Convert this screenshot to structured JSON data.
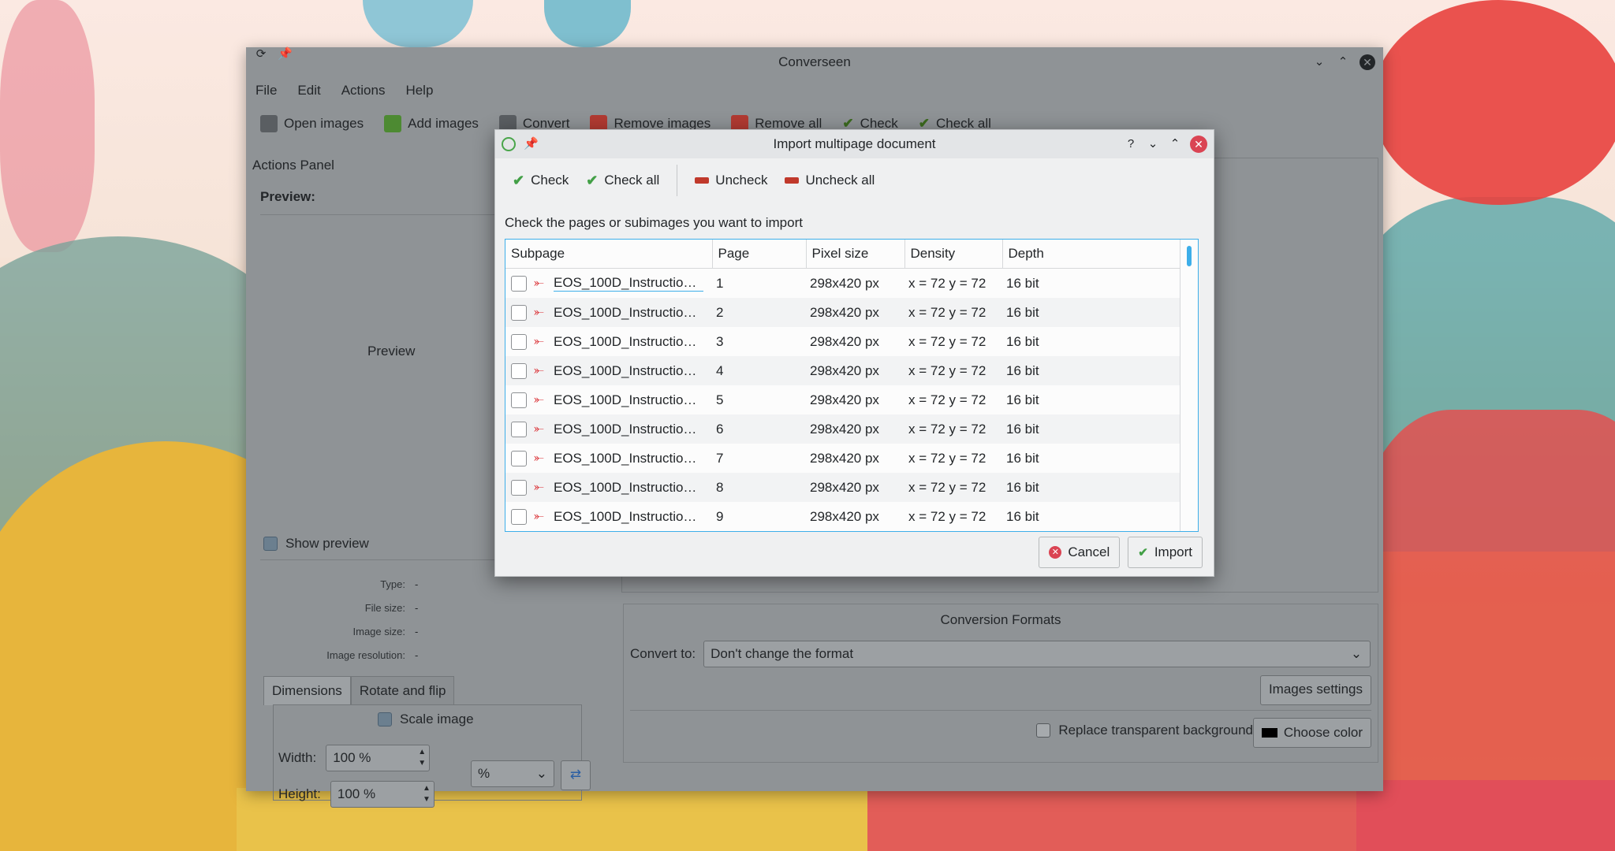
{
  "main_window": {
    "title": "Converseen",
    "menu": [
      "File",
      "Edit",
      "Actions",
      "Help"
    ],
    "toolbar": [
      {
        "label": "Open images",
        "icon": "open-images-icon"
      },
      {
        "label": "Add images",
        "icon": "add-images-icon"
      },
      {
        "label": "Convert",
        "icon": "convert-icon"
      },
      {
        "label": "Remove images",
        "icon": "remove-images-icon"
      },
      {
        "label": "Remove all",
        "icon": "remove-all-icon"
      },
      {
        "label": "Check",
        "icon": "check-icon"
      },
      {
        "label": "Check all",
        "icon": "check-all-icon"
      }
    ],
    "actions_panel": {
      "title": "Actions Panel",
      "preview_label": "Preview:",
      "preview_placeholder": "Preview",
      "show_preview_label": "Show preview",
      "info": [
        {
          "key": "Type:",
          "value": "-"
        },
        {
          "key": "File size:",
          "value": "-"
        },
        {
          "key": "Image size:",
          "value": "-"
        },
        {
          "key": "Image resolution:",
          "value": "-"
        }
      ],
      "tabs": [
        "Dimensions",
        "Rotate and flip"
      ],
      "scale_image_label": "Scale image",
      "width_label": "Width:",
      "width_value": "100 %",
      "height_label": "Height:",
      "height_value": "100 %",
      "unit_value": "%"
    },
    "conversion_formats": {
      "title": "Conversion Formats",
      "convert_to_label": "Convert to:",
      "convert_to_value": "Don't change the format",
      "images_settings_label": "Images settings",
      "replace_bg_label": "Replace transparent background",
      "choose_color_label": "Choose color"
    }
  },
  "dialog": {
    "title": "Import multipage document",
    "toolbar": {
      "check": "Check",
      "check_all": "Check all",
      "uncheck": "Uncheck",
      "uncheck_all": "Uncheck all"
    },
    "instruction": "Check the pages or subimages you want to import",
    "columns": [
      "Subpage",
      "Page",
      "Pixel size",
      "Density",
      "Depth"
    ],
    "rows": [
      {
        "subpage": "EOS_100D_Instruction_...",
        "page": "1",
        "pixel_size": "298x420 px",
        "density": "x = 72 y = 72",
        "depth": "16 bit"
      },
      {
        "subpage": "EOS_100D_Instruction_...",
        "page": "2",
        "pixel_size": "298x420 px",
        "density": "x = 72 y = 72",
        "depth": "16 bit"
      },
      {
        "subpage": "EOS_100D_Instruction_...",
        "page": "3",
        "pixel_size": "298x420 px",
        "density": "x = 72 y = 72",
        "depth": "16 bit"
      },
      {
        "subpage": "EOS_100D_Instruction_...",
        "page": "4",
        "pixel_size": "298x420 px",
        "density": "x = 72 y = 72",
        "depth": "16 bit"
      },
      {
        "subpage": "EOS_100D_Instruction_...",
        "page": "5",
        "pixel_size": "298x420 px",
        "density": "x = 72 y = 72",
        "depth": "16 bit"
      },
      {
        "subpage": "EOS_100D_Instruction_...",
        "page": "6",
        "pixel_size": "298x420 px",
        "density": "x = 72 y = 72",
        "depth": "16 bit"
      },
      {
        "subpage": "EOS_100D_Instruction_...",
        "page": "7",
        "pixel_size": "298x420 px",
        "density": "x = 72 y = 72",
        "depth": "16 bit"
      },
      {
        "subpage": "EOS_100D_Instruction_...",
        "page": "8",
        "pixel_size": "298x420 px",
        "density": "x = 72 y = 72",
        "depth": "16 bit"
      },
      {
        "subpage": "EOS_100D_Instruction_...",
        "page": "9",
        "pixel_size": "298x420 px",
        "density": "x = 72 y = 72",
        "depth": "16 bit"
      }
    ],
    "cancel_label": "Cancel",
    "import_label": "Import"
  },
  "colors": {
    "accent": "#3daee9",
    "close_red": "#da4453",
    "check_green": "#43a047",
    "uncheck_red": "#c0392b"
  }
}
